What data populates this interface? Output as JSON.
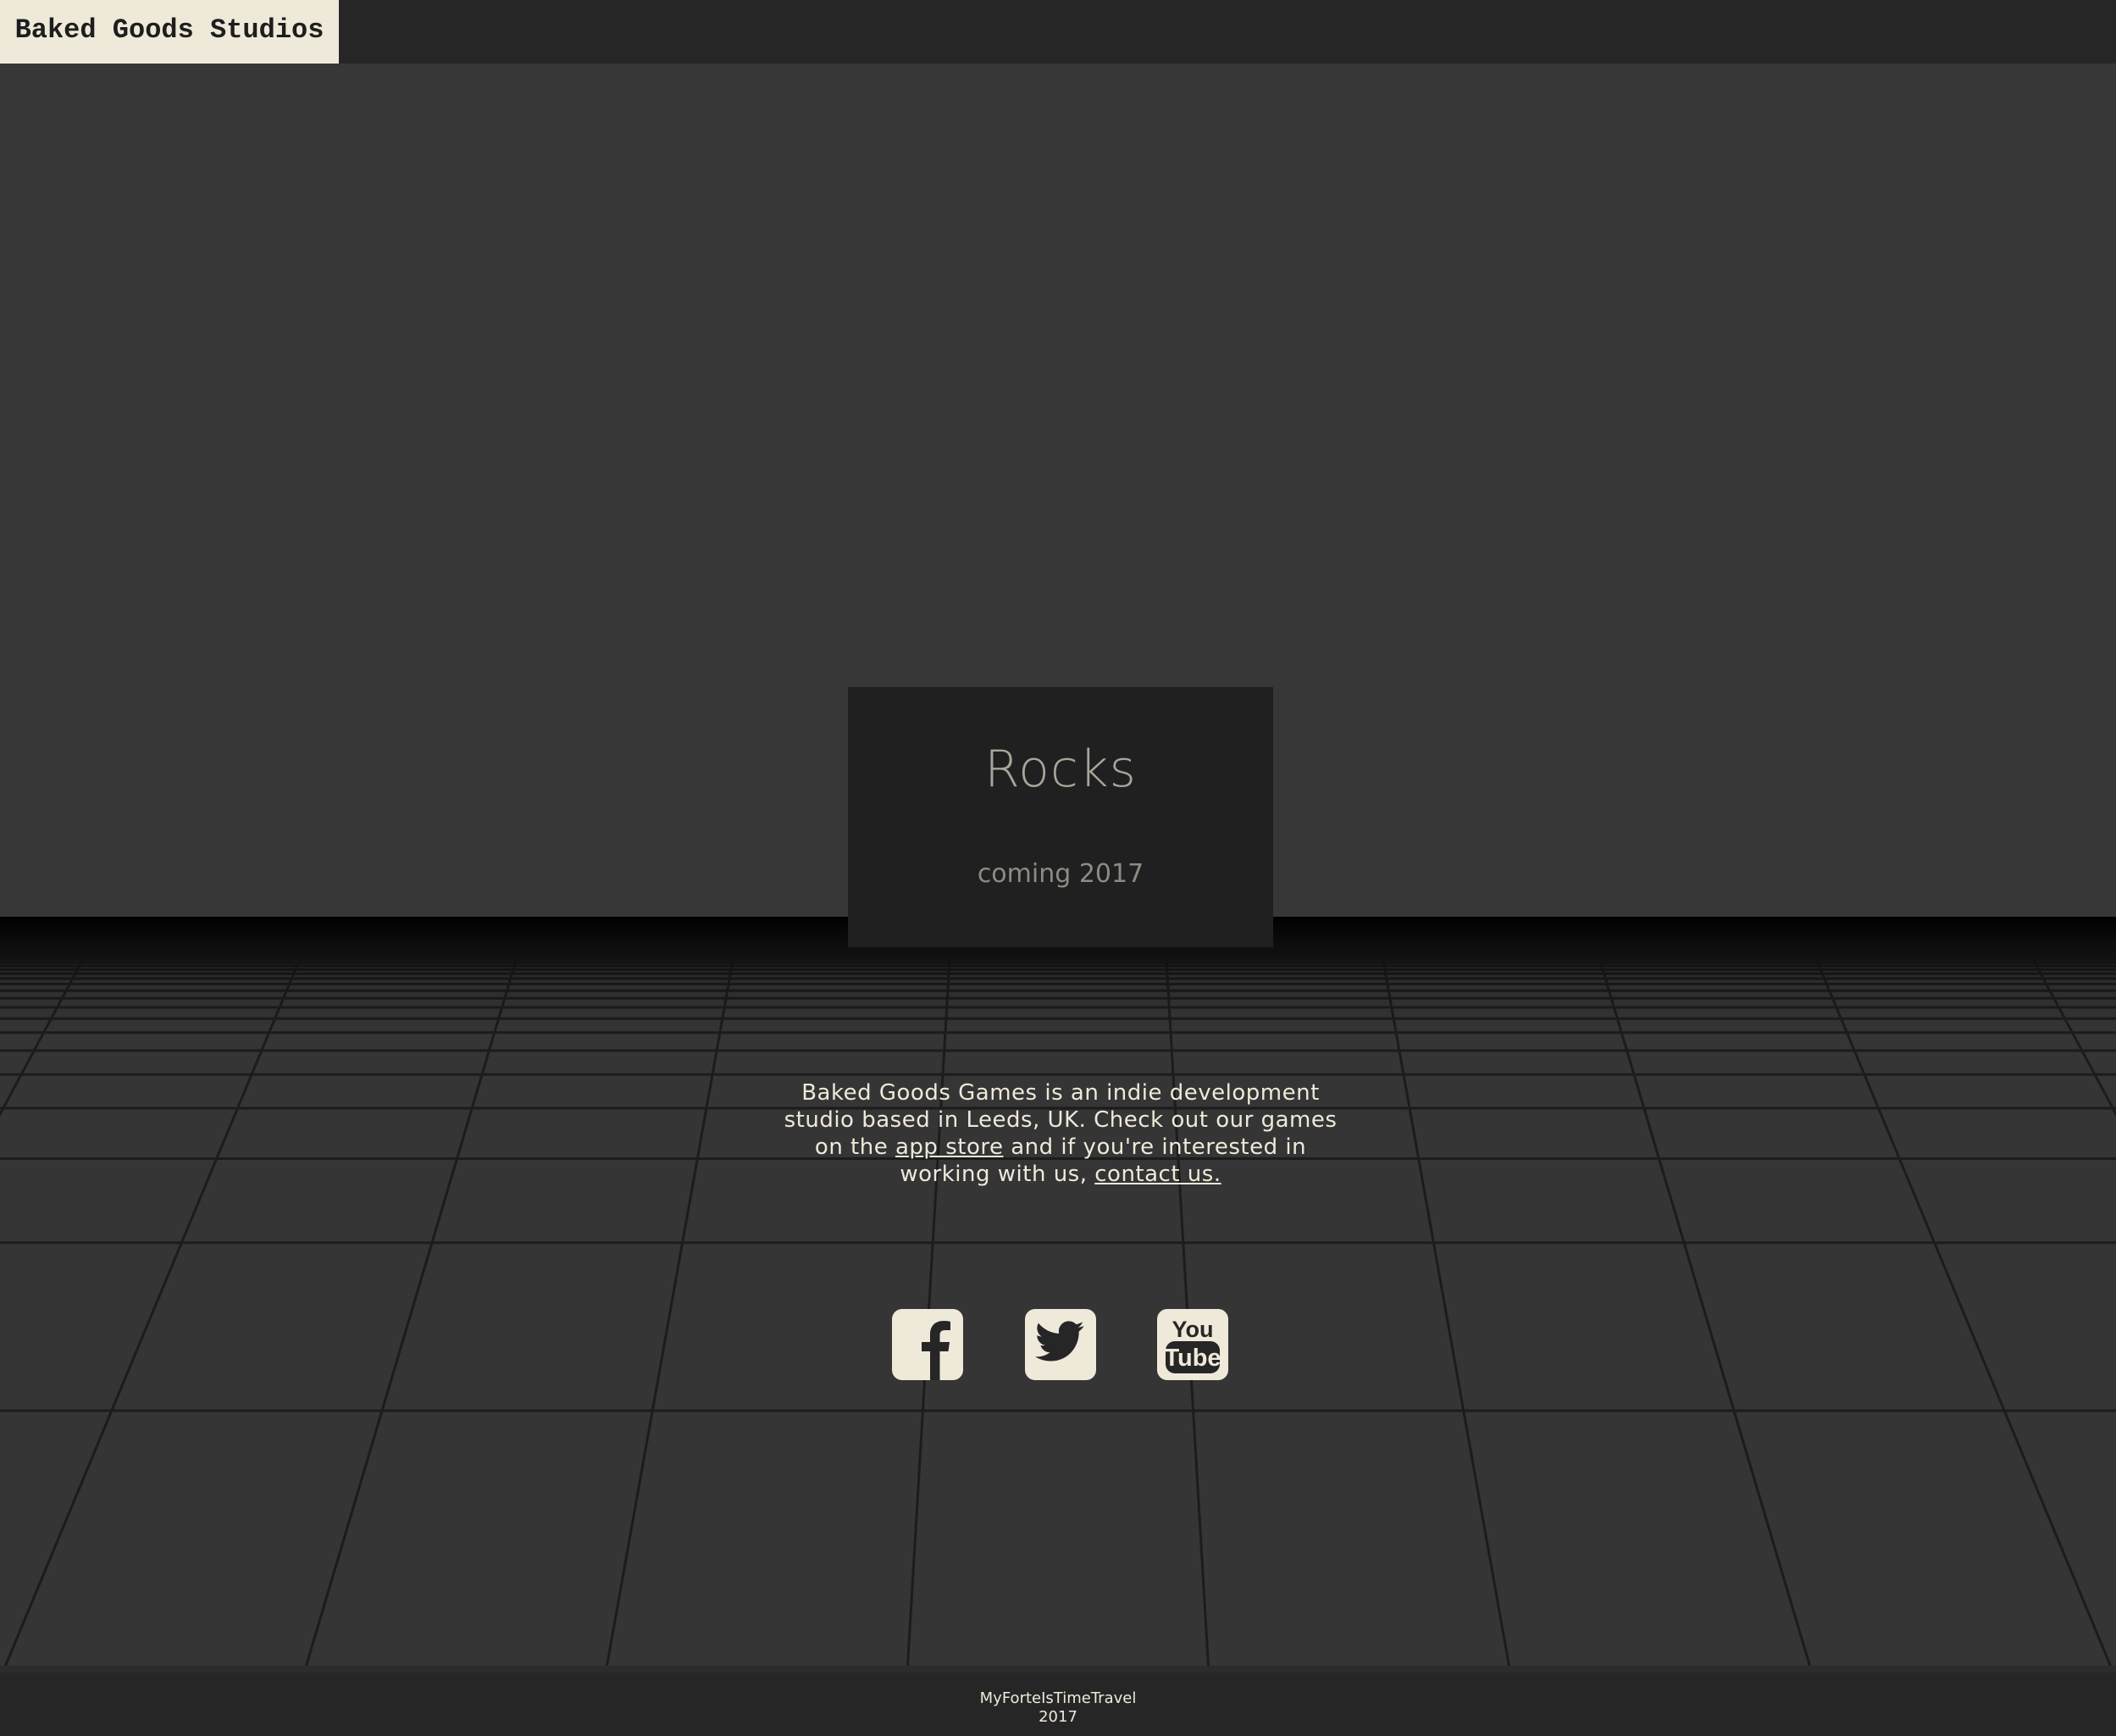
{
  "header": {
    "brand": "Baked Goods Studios"
  },
  "hero": {
    "title": "Rocks",
    "subtitle": "coming 2017"
  },
  "about": {
    "text_1": "Baked Goods Games is an indie development studio based in Leeds, UK. Check out our games on the ",
    "link_app_store": "app store",
    "text_2": " and if you're interested in working with us, ",
    "link_contact": "contact us."
  },
  "social": {
    "icons": [
      "facebook-icon",
      "twitter-icon",
      "youtube-icon"
    ],
    "youtube_you": "You",
    "youtube_tube": "Tube"
  },
  "footer": {
    "line_1": "MyForteIsTimeTravel",
    "line_2": "2017"
  },
  "colors": {
    "background": "#373737",
    "bar": "#262626",
    "cream": "#efe9da",
    "card": "#202020",
    "grid_line": "#1a1a1a"
  }
}
